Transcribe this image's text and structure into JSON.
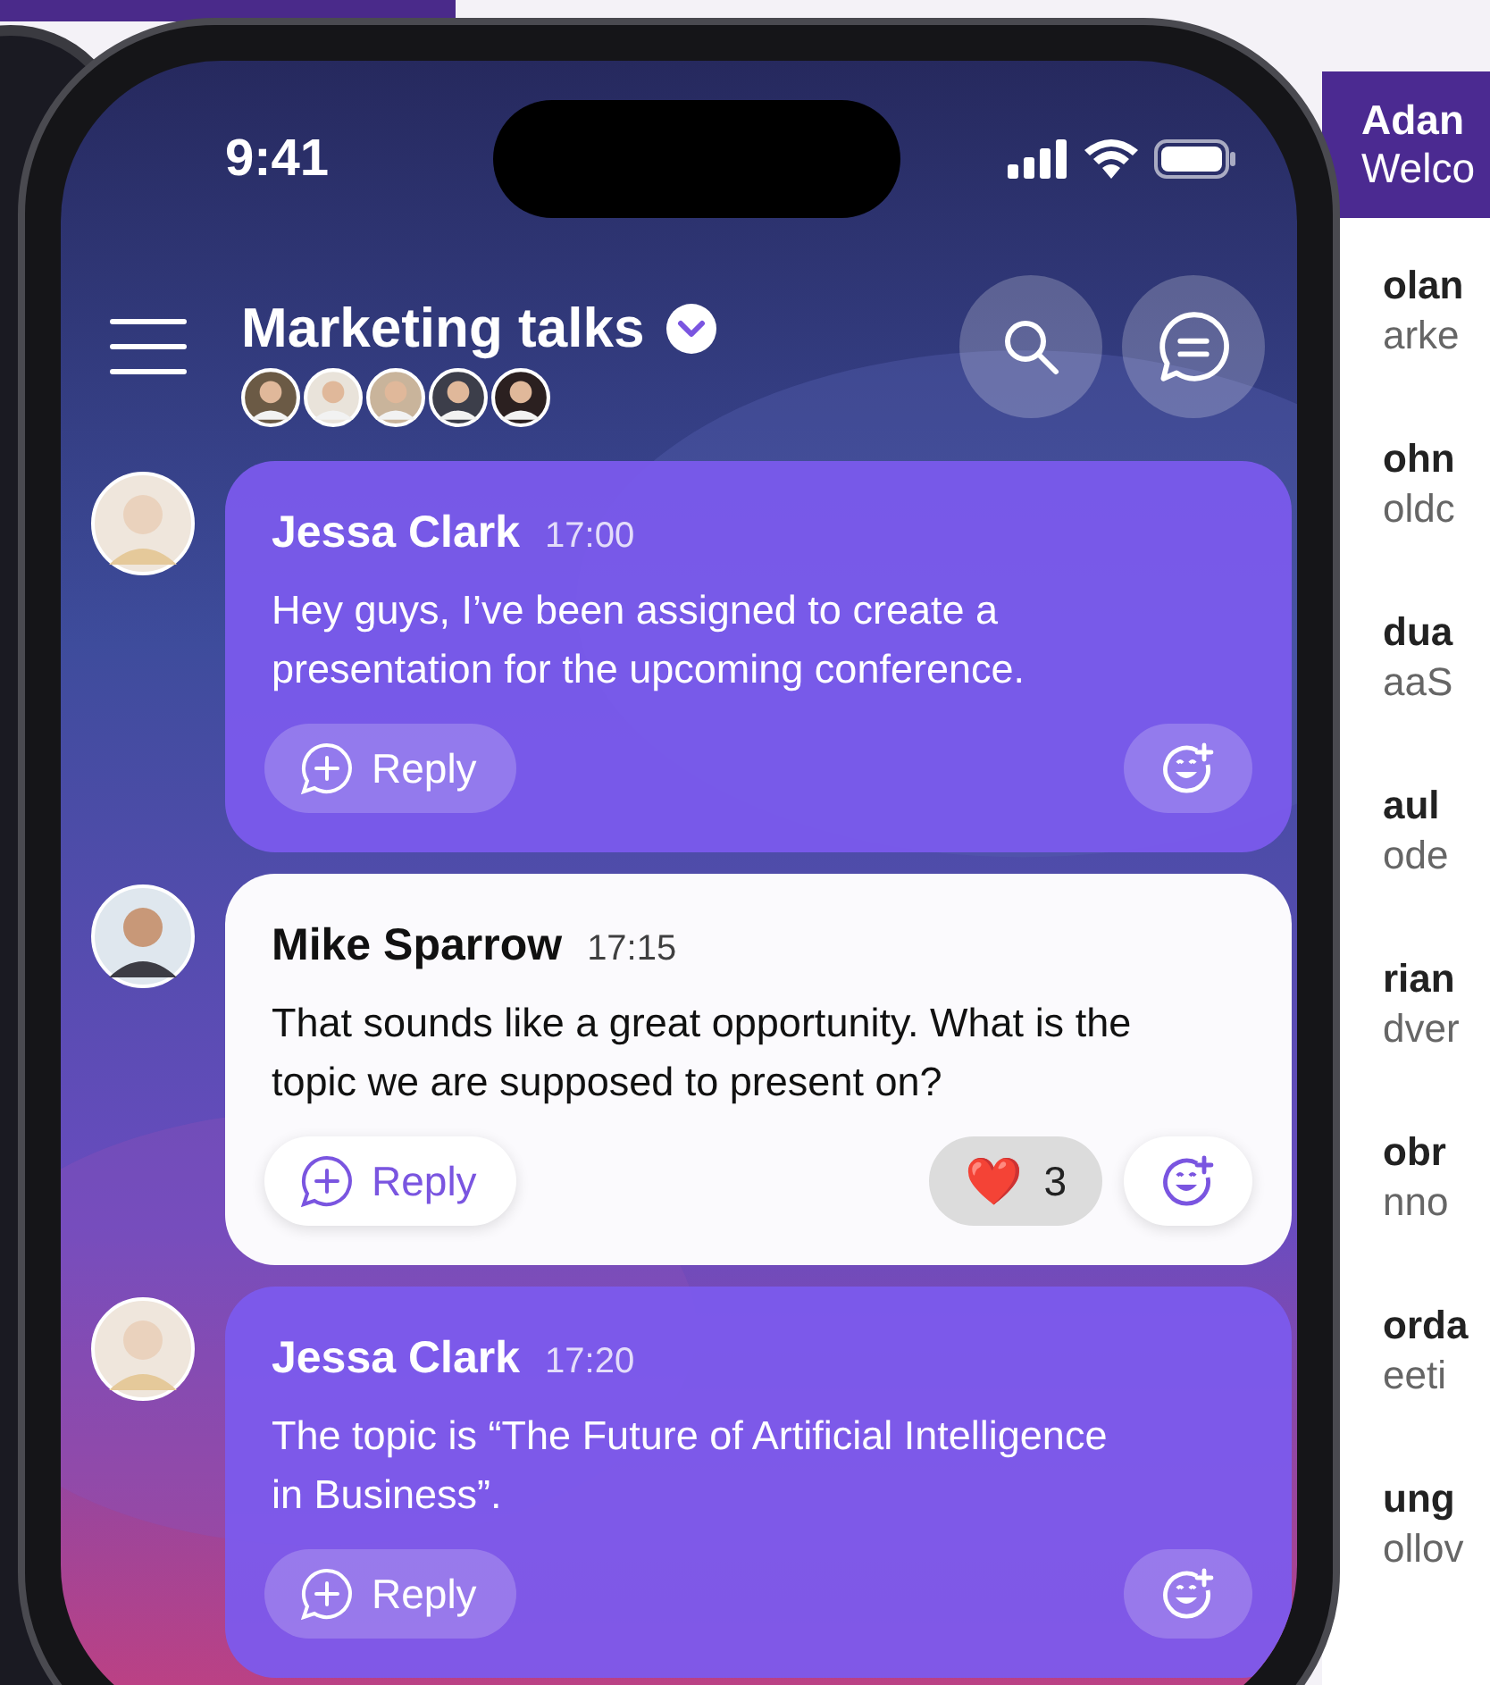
{
  "status_bar": {
    "time": "9:41"
  },
  "header": {
    "title": "Marketing talks"
  },
  "messages": [
    {
      "author": "Jessa Clark",
      "time": "17:00",
      "text": "Hey guys, I’ve been assigned to create a presentation for the upcoming conference.",
      "kind": "standard",
      "reply_label": "Reply"
    },
    {
      "author": "Mike Sparrow",
      "time": "17:15",
      "text": "That sounds like a great opportunity. What is the topic we are supposed to present on?",
      "kind": "highlighted",
      "reply_label": "Reply",
      "reaction": {
        "emoji": "❤️",
        "count": "3"
      }
    },
    {
      "author": "Jessa Clark",
      "time": "17:20",
      "text": "The topic is “The Future of Artificial Intelligence in Business”.",
      "kind": "standard",
      "reply_label": "Reply"
    }
  ],
  "side_panel": {
    "header_name": "Adan",
    "header_subtitle": "Welco",
    "items": [
      {
        "name": "olan",
        "subtitle": "arke"
      },
      {
        "name": "ohn",
        "subtitle": "oldc"
      },
      {
        "name": "dua",
        "subtitle": "aaS"
      },
      {
        "name": "aul",
        "subtitle": "ode"
      },
      {
        "name": "rian",
        "subtitle": "dver"
      },
      {
        "name": "obr",
        "subtitle": "nno"
      },
      {
        "name": "orda",
        "subtitle": "eeti"
      },
      {
        "name": "ung",
        "subtitle": "ollov"
      }
    ]
  }
}
